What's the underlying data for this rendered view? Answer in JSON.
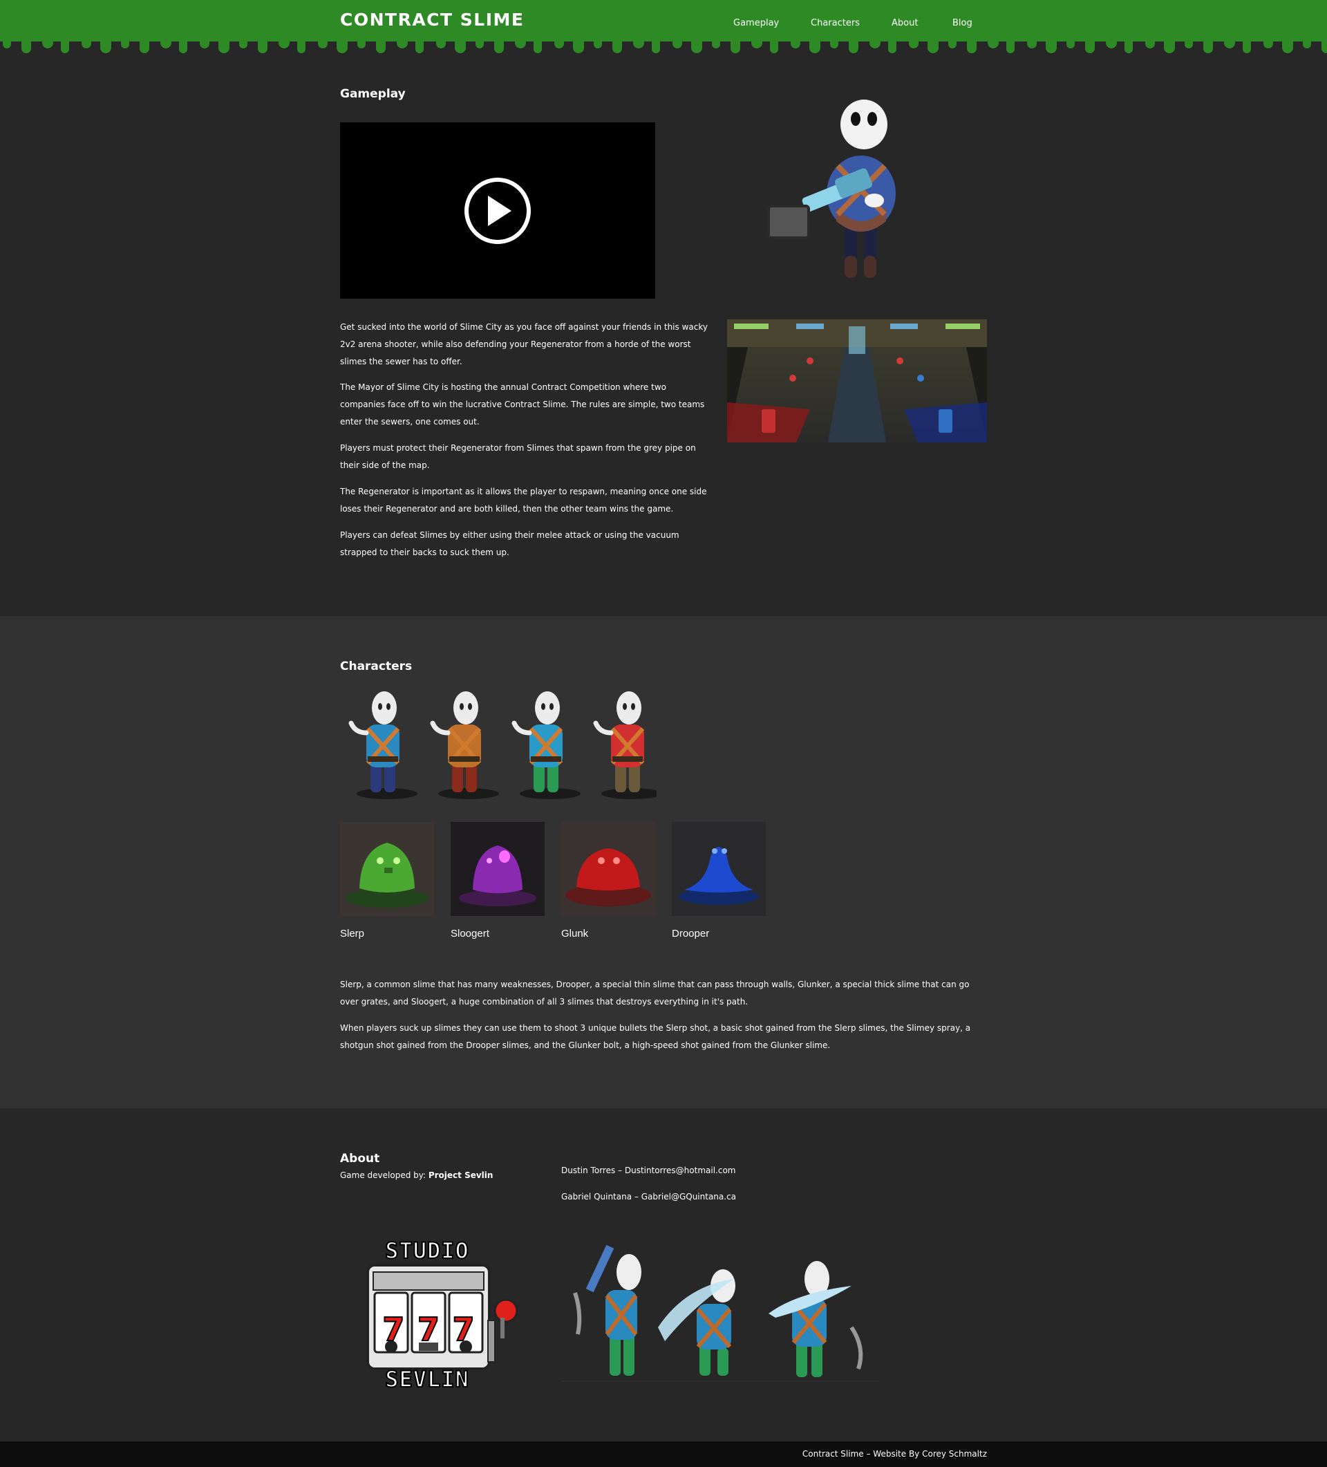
{
  "header": {
    "logo": "CONTRACT SLIME",
    "nav": [
      "Gameplay",
      "Characters",
      "About",
      "Blog"
    ]
  },
  "gameplay": {
    "title": "Gameplay",
    "paragraphs": [
      "Get sucked into the world of Slime City as you face off against your friends in this wacky 2v2 arena shooter, while also defending your Regenerator from a horde of the worst slimes the sewer has to offer.",
      "The Mayor of Slime City is hosting the annual Contract Competition where two companies face off to win the lucrative Contract Slime. The rules are simple, two teams enter the sewers, one comes out.",
      "Players must protect their Regenerator from Slimes that spawn from the grey pipe on their side of the map.",
      "The Regenerator is important as it allows the player to respawn, meaning once one side loses their Regenerator and are both killed, then the other team wins the game.",
      "Players can defeat Slimes by either using their melee attack or using the vacuum strapped to their backs to suck them up."
    ]
  },
  "characters": {
    "title": "Characters",
    "slimes": [
      "Slerp",
      "Sloogert",
      "Glunk",
      "Drooper"
    ],
    "paragraphs": [
      "Slerp, a common slime that has many weaknesses, Drooper, a special thin slime that can pass through walls, Glunker, a special thick slime that can go over grates, and Sloogert, a huge combination of all 3 slimes that destroys everything in it's path.",
      "When players suck up slimes they can use them to shoot 3 unique bullets the Slerp shot, a basic shot gained from the Slerp slimes, the Slimey spray, a shotgun shot gained from the Drooper slimes, and the Glunker bolt, a high-speed shot gained from the Glunker slime."
    ]
  },
  "about": {
    "title": "About",
    "developed_by": "Game developed by: ",
    "studio": "Project Sevlin",
    "contacts": [
      "Dustin Torres – Dustintorres@hotmail.com",
      "Gabriel Quintana – Gabriel@GQuintana.ca"
    ],
    "studio_logo_top": "STUDIO",
    "studio_logo_bottom": "SEVLIN",
    "reel_digits": [
      "7",
      "7",
      "7"
    ]
  },
  "footer": {
    "text": "Contract Slime – Website By Corey Schmaltz"
  },
  "colors": {
    "header_green": "#2e8a25",
    "page_bg": "#272727",
    "characters_bg": "#323233",
    "footer_bg": "#0d0d0d"
  }
}
